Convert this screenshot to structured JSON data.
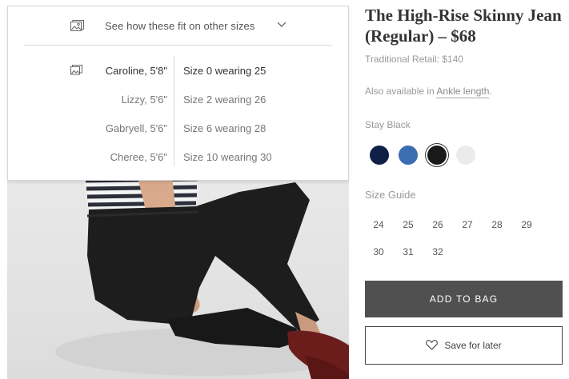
{
  "fit": {
    "title": "See how these fit on other sizes",
    "rows": [
      {
        "model": "Caroline, 5'8\"",
        "size": "Size 0 wearing 25",
        "active": true
      },
      {
        "model": "Lizzy, 5'6\"",
        "size": "Size 2 wearing 26",
        "active": false
      },
      {
        "model": "Gabryell, 5'6\"",
        "size": "Size 6 wearing 28",
        "active": false
      },
      {
        "model": "Cheree, 5'6\"",
        "size": "Size 10 wearing 30",
        "active": false
      }
    ]
  },
  "product": {
    "title": "The High-Rise Skinny Jean (Regular) – $68",
    "retail": "Traditional Retail: $140",
    "available_prefix": "Also available in ",
    "available_link": "Ankle length",
    "available_suffix": ".",
    "color_name": "Stay Black"
  },
  "swatches": [
    {
      "name": "navy",
      "color": "#0f1f45"
    },
    {
      "name": "blue",
      "color": "#3b6db3"
    },
    {
      "name": "black",
      "color": "#1a1a1a",
      "selected": true
    },
    {
      "name": "white",
      "color": "#ebebe9"
    }
  ],
  "size_guide": {
    "label": "Size Guide",
    "sizes": [
      "24",
      "25",
      "26",
      "27",
      "28",
      "29",
      "30",
      "31",
      "32"
    ]
  },
  "actions": {
    "add_to_bag": "ADD TO BAG",
    "save_for_later": "Save for later"
  }
}
